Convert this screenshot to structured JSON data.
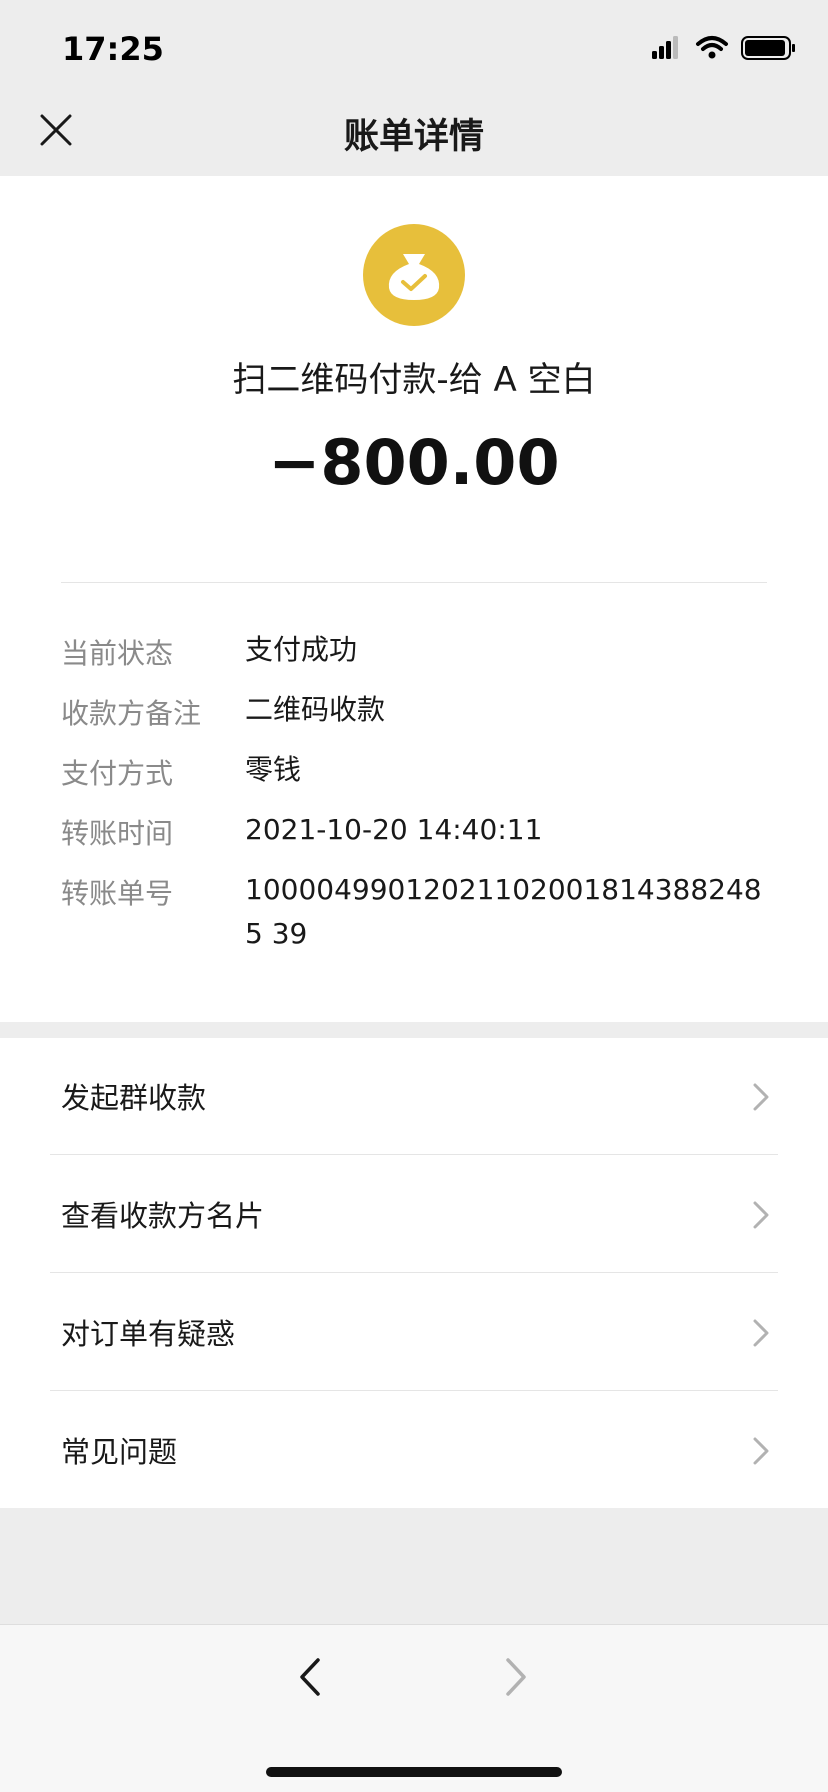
{
  "status_bar": {
    "time": "17:25"
  },
  "nav": {
    "title": "账单详情"
  },
  "transaction": {
    "merchant": "扫二维码付款-给 A 空白",
    "amount": "−800.00"
  },
  "details": [
    {
      "label": "当前状态",
      "value": "支付成功"
    },
    {
      "label": "收款方备注",
      "value": "二维码收款"
    },
    {
      "label": "支付方式",
      "value": "零钱"
    },
    {
      "label": "转账时间",
      "value": "2021-10-20 14:40:11"
    },
    {
      "label": "转账单号",
      "value": "100004990120211020018143882485 39"
    }
  ],
  "menu": [
    {
      "label": "发起群收款"
    },
    {
      "label": "查看收款方名片"
    },
    {
      "label": "对订单有疑惑"
    },
    {
      "label": "常见问题"
    }
  ],
  "colors": {
    "accent_icon": "#e7bf3b",
    "background": "#ededed",
    "card": "#ffffff"
  }
}
